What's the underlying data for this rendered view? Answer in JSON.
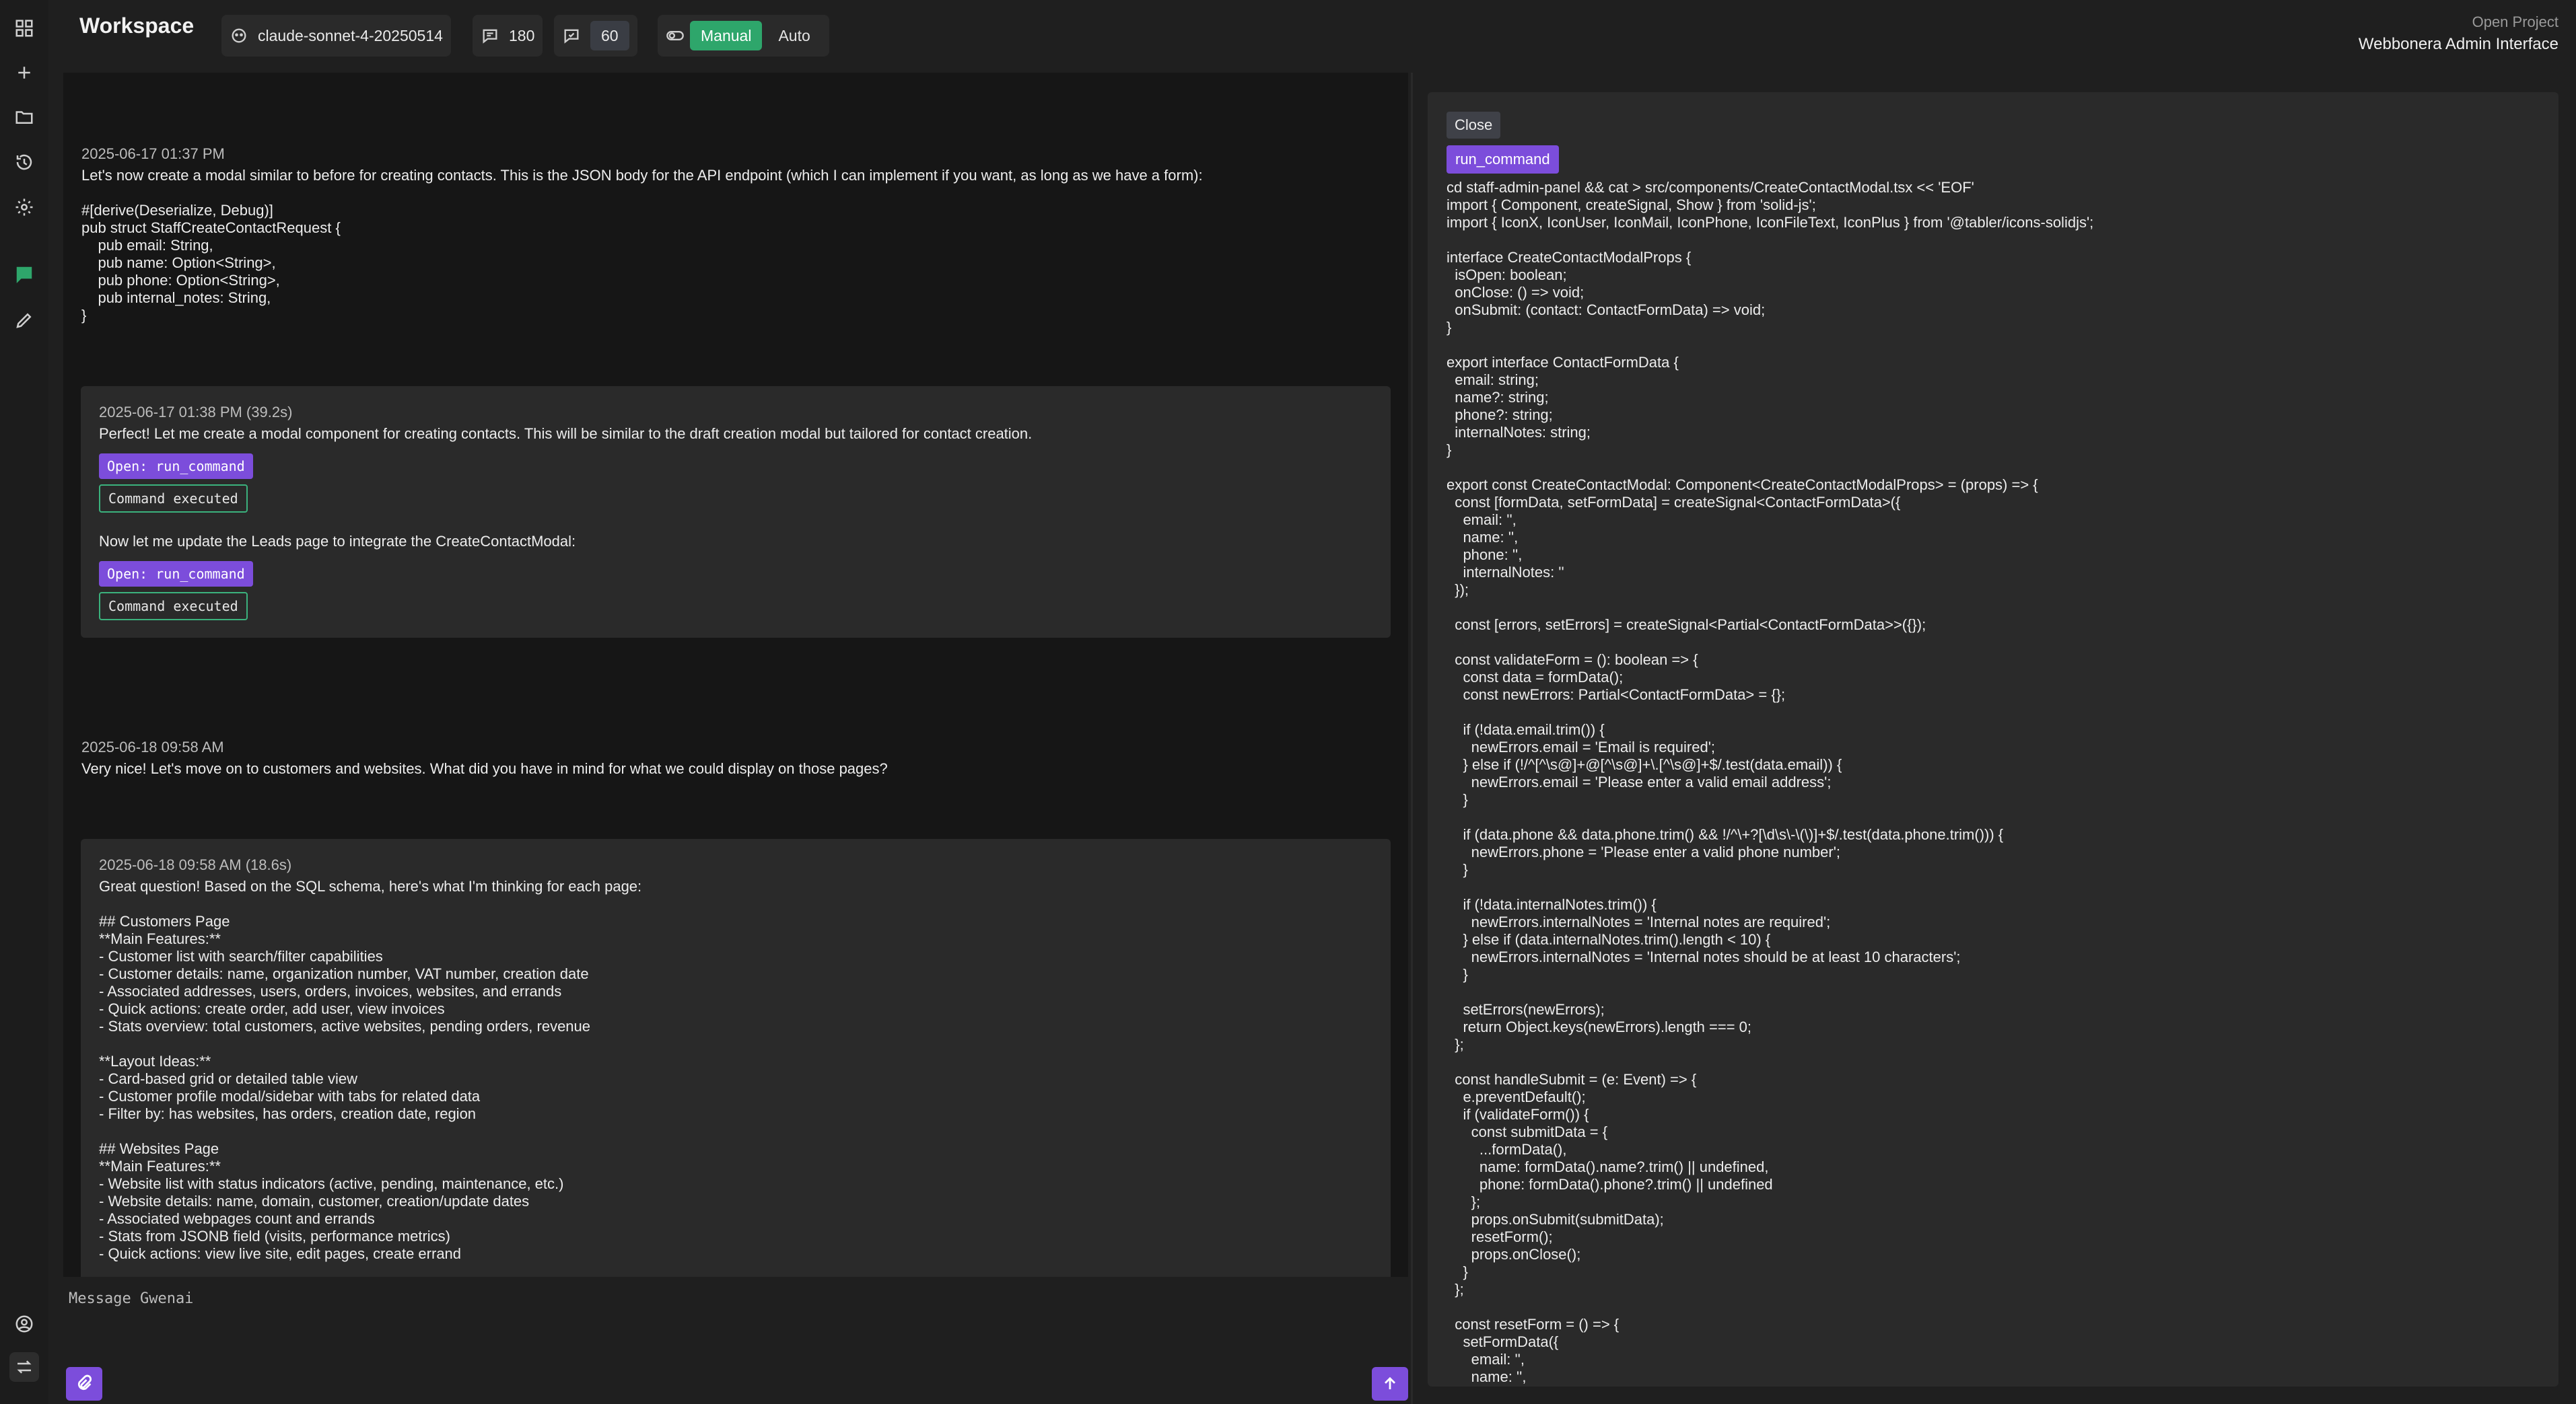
{
  "app": {
    "title": "Workspace"
  },
  "toolbar": {
    "model": "claude-sonnet-4-20250514",
    "count_a": "180",
    "count_b": "60",
    "mode_manual": "Manual",
    "mode_auto": "Auto"
  },
  "project": {
    "label": "Open Project",
    "name": "Webbonera Admin Interface"
  },
  "rail": {
    "icons": [
      "grid-icon",
      "plus-icon",
      "folder-icon",
      "history-icon",
      "settings-icon",
      "chat-icon",
      "pencil-icon",
      "user-icon",
      "swap-icon"
    ]
  },
  "messages": {
    "m1": {
      "time": "2025-06-17 01:37 PM",
      "text": "Let's now create a modal similar to before for creating contacts. This is the JSON body for the API endpoint (which I can implement if you want, as long as we have a form):\n\n#[derive(Deserialize, Debug)]\npub struct StaffCreateContactRequest {\n    pub email: String,\n    pub name: Option<String>,\n    pub phone: Option<String>,\n    pub internal_notes: String,\n}"
    },
    "m2": {
      "time": "2025-06-17 01:38 PM (39.2s)",
      "text1": "Perfect! Let me create a modal component for creating contacts. This will be similar to the draft creation modal but tailored for contact creation.",
      "open1": "Open: run_command",
      "done1": "Command executed",
      "text2": "Now let me update the Leads page to integrate the CreateContactModal:",
      "open2": "Open: run_command",
      "done2": "Command executed"
    },
    "m3": {
      "time": "2025-06-18 09:58 AM",
      "text": "Very nice! Let's move on to customers and websites. What did you have in mind for what we could display on those pages?"
    },
    "m4": {
      "time": "2025-06-18 09:58 AM (18.6s)",
      "text": "Great question! Based on the SQL schema, here's what I'm thinking for each page:\n\n## Customers Page\n**Main Features:**\n- Customer list with search/filter capabilities\n- Customer details: name, organization number, VAT number, creation date\n- Associated addresses, users, orders, invoices, websites, and errands\n- Quick actions: create order, add user, view invoices\n- Stats overview: total customers, active websites, pending orders, revenue\n\n**Layout Ideas:**\n- Card-based grid or detailed table view\n- Customer profile modal/sidebar with tabs for related data\n- Filter by: has websites, has orders, creation date, region\n\n## Websites Page\n**Main Features:**\n- Website list with status indicators (active, pending, maintenance, etc.)\n- Website details: name, domain, customer, creation/update dates\n- Associated webpages count and errands\n- Stats from JSONB field (visits, performance metrics)\n- Quick actions: view live site, edit pages, create errand"
    }
  },
  "composer": {
    "placeholder": "Message Gwenai"
  },
  "side": {
    "close": "Close",
    "tool": "run_command",
    "code": "cd staff-admin-panel && cat > src/components/CreateContactModal.tsx << 'EOF'\nimport { Component, createSignal, Show } from 'solid-js';\nimport { IconX, IconUser, IconMail, IconPhone, IconFileText, IconPlus } from '@tabler/icons-solidjs';\n\ninterface CreateContactModalProps {\n  isOpen: boolean;\n  onClose: () => void;\n  onSubmit: (contact: ContactFormData) => void;\n}\n\nexport interface ContactFormData {\n  email: string;\n  name?: string;\n  phone?: string;\n  internalNotes: string;\n}\n\nexport const CreateContactModal: Component<CreateContactModalProps> = (props) => {\n  const [formData, setFormData] = createSignal<ContactFormData>({\n    email: '',\n    name: '',\n    phone: '',\n    internalNotes: ''\n  });\n\n  const [errors, setErrors] = createSignal<Partial<ContactFormData>>({});\n\n  const validateForm = (): boolean => {\n    const data = formData();\n    const newErrors: Partial<ContactFormData> = {};\n\n    if (!data.email.trim()) {\n      newErrors.email = 'Email is required';\n    } else if (!/^[^\\s@]+@[^\\s@]+\\.[^\\s@]+$/.test(data.email)) {\n      newErrors.email = 'Please enter a valid email address';\n    }\n\n    if (data.phone && data.phone.trim() && !/^\\+?[\\d\\s\\-\\(\\)]+$/.test(data.phone.trim())) {\n      newErrors.phone = 'Please enter a valid phone number';\n    }\n\n    if (!data.internalNotes.trim()) {\n      newErrors.internalNotes = 'Internal notes are required';\n    } else if (data.internalNotes.trim().length < 10) {\n      newErrors.internalNotes = 'Internal notes should be at least 10 characters';\n    }\n\n    setErrors(newErrors);\n    return Object.keys(newErrors).length === 0;\n  };\n\n  const handleSubmit = (e: Event) => {\n    e.preventDefault();\n    if (validateForm()) {\n      const submitData = {\n        ...formData(),\n        name: formData().name?.trim() || undefined,\n        phone: formData().phone?.trim() || undefined\n      };\n      props.onSubmit(submitData);\n      resetForm();\n      props.onClose();\n    }\n  };\n\n  const resetForm = () => {\n    setFormData({\n      email: '',\n      name: '',"
  },
  "colors": {
    "accent": "#7c4ddb",
    "green": "#2ea66b",
    "panel": "#2a2a2a"
  }
}
